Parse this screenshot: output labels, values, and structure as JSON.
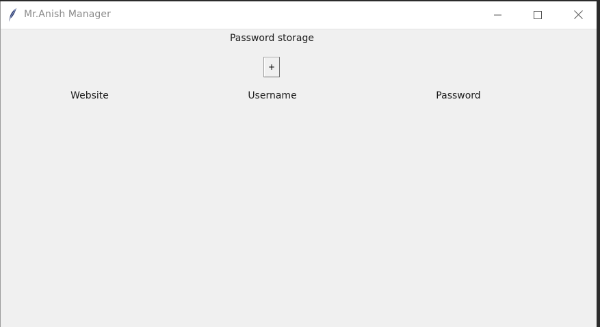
{
  "window": {
    "title": "Mr.Anish Manager",
    "app_icon": "feather-icon",
    "controls": {
      "minimize_icon": "minimize-icon",
      "maximize_icon": "maximize-icon",
      "close_icon": "close-icon"
    }
  },
  "main": {
    "heading": "Password storage",
    "add_button_label": "+",
    "columns": [
      "Website",
      "Username",
      "Password"
    ]
  }
}
